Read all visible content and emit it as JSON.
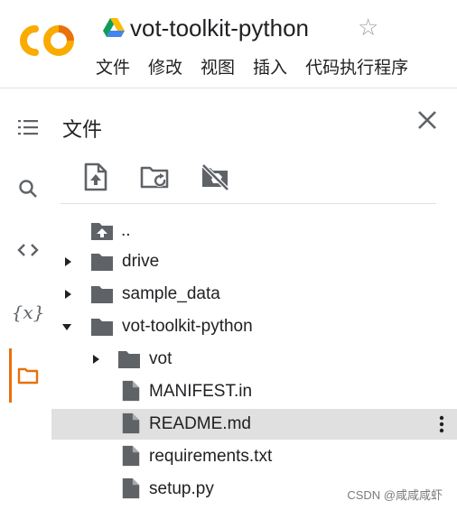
{
  "header": {
    "notebook_title": "vot-toolkit-python",
    "menu": [
      "文件",
      "修改",
      "视图",
      "插入",
      "代码执行程序"
    ]
  },
  "panel": {
    "title": "文件"
  },
  "tree": [
    {
      "label": "..",
      "type": "up"
    },
    {
      "label": "drive",
      "type": "folder",
      "expanded": false
    },
    {
      "label": "sample_data",
      "type": "folder",
      "expanded": false
    },
    {
      "label": "vot-toolkit-python",
      "type": "folder",
      "expanded": true
    },
    {
      "label": "vot",
      "type": "folder",
      "expanded": false
    },
    {
      "label": "MANIFEST.in",
      "type": "file"
    },
    {
      "label": "README.md",
      "type": "file",
      "selected": true
    },
    {
      "label": "requirements.txt",
      "type": "file"
    },
    {
      "label": "setup.py",
      "type": "file"
    }
  ],
  "watermark": "CSDN @咸咸咸虾",
  "colors": {
    "logo_orange": "#f9ab00",
    "logo_dark_orange": "#e8710a",
    "accent": "#e8710a",
    "icon_grey": "#5f6368",
    "selected_row": "#e0e0e0"
  }
}
